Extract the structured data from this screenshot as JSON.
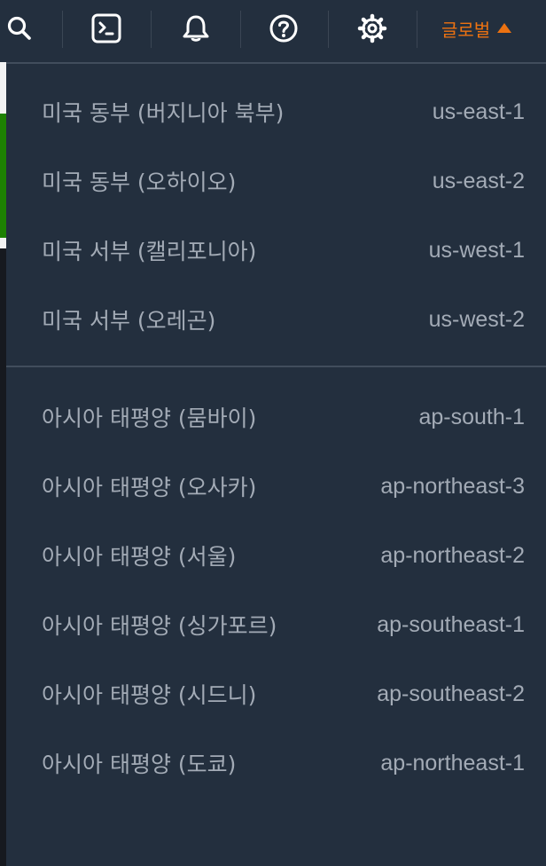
{
  "topbar": {
    "region_label": "글로벌",
    "icons": [
      "search-icon",
      "cloudshell-icon",
      "bell-icon",
      "help-icon",
      "gear-icon"
    ]
  },
  "dropdown": {
    "groups": [
      {
        "regions": [
          {
            "name": "미국 동부 (버지니아 북부)",
            "code": "us-east-1"
          },
          {
            "name": "미국 동부 (오하이오)",
            "code": "us-east-2"
          },
          {
            "name": "미국 서부 (캘리포니아)",
            "code": "us-west-1"
          },
          {
            "name": "미국 서부 (오레곤)",
            "code": "us-west-2"
          }
        ]
      },
      {
        "regions": [
          {
            "name": "아시아 태평양 (뭄바이)",
            "code": "ap-south-1"
          },
          {
            "name": "아시아 태평양 (오사카)",
            "code": "ap-northeast-3"
          },
          {
            "name": "아시아 태평양 (서울)",
            "code": "ap-northeast-2"
          },
          {
            "name": "아시아 태평양 (싱가포르)",
            "code": "ap-southeast-1"
          },
          {
            "name": "아시아 태평양 (시드니)",
            "code": "ap-southeast-2"
          },
          {
            "name": "아시아 태평양 (도쿄)",
            "code": "ap-northeast-1"
          }
        ]
      }
    ]
  },
  "colors": {
    "background": "#232f3e",
    "accent": "#ec7211",
    "text_muted": "#a3abb6",
    "divider": "#414d5c"
  }
}
